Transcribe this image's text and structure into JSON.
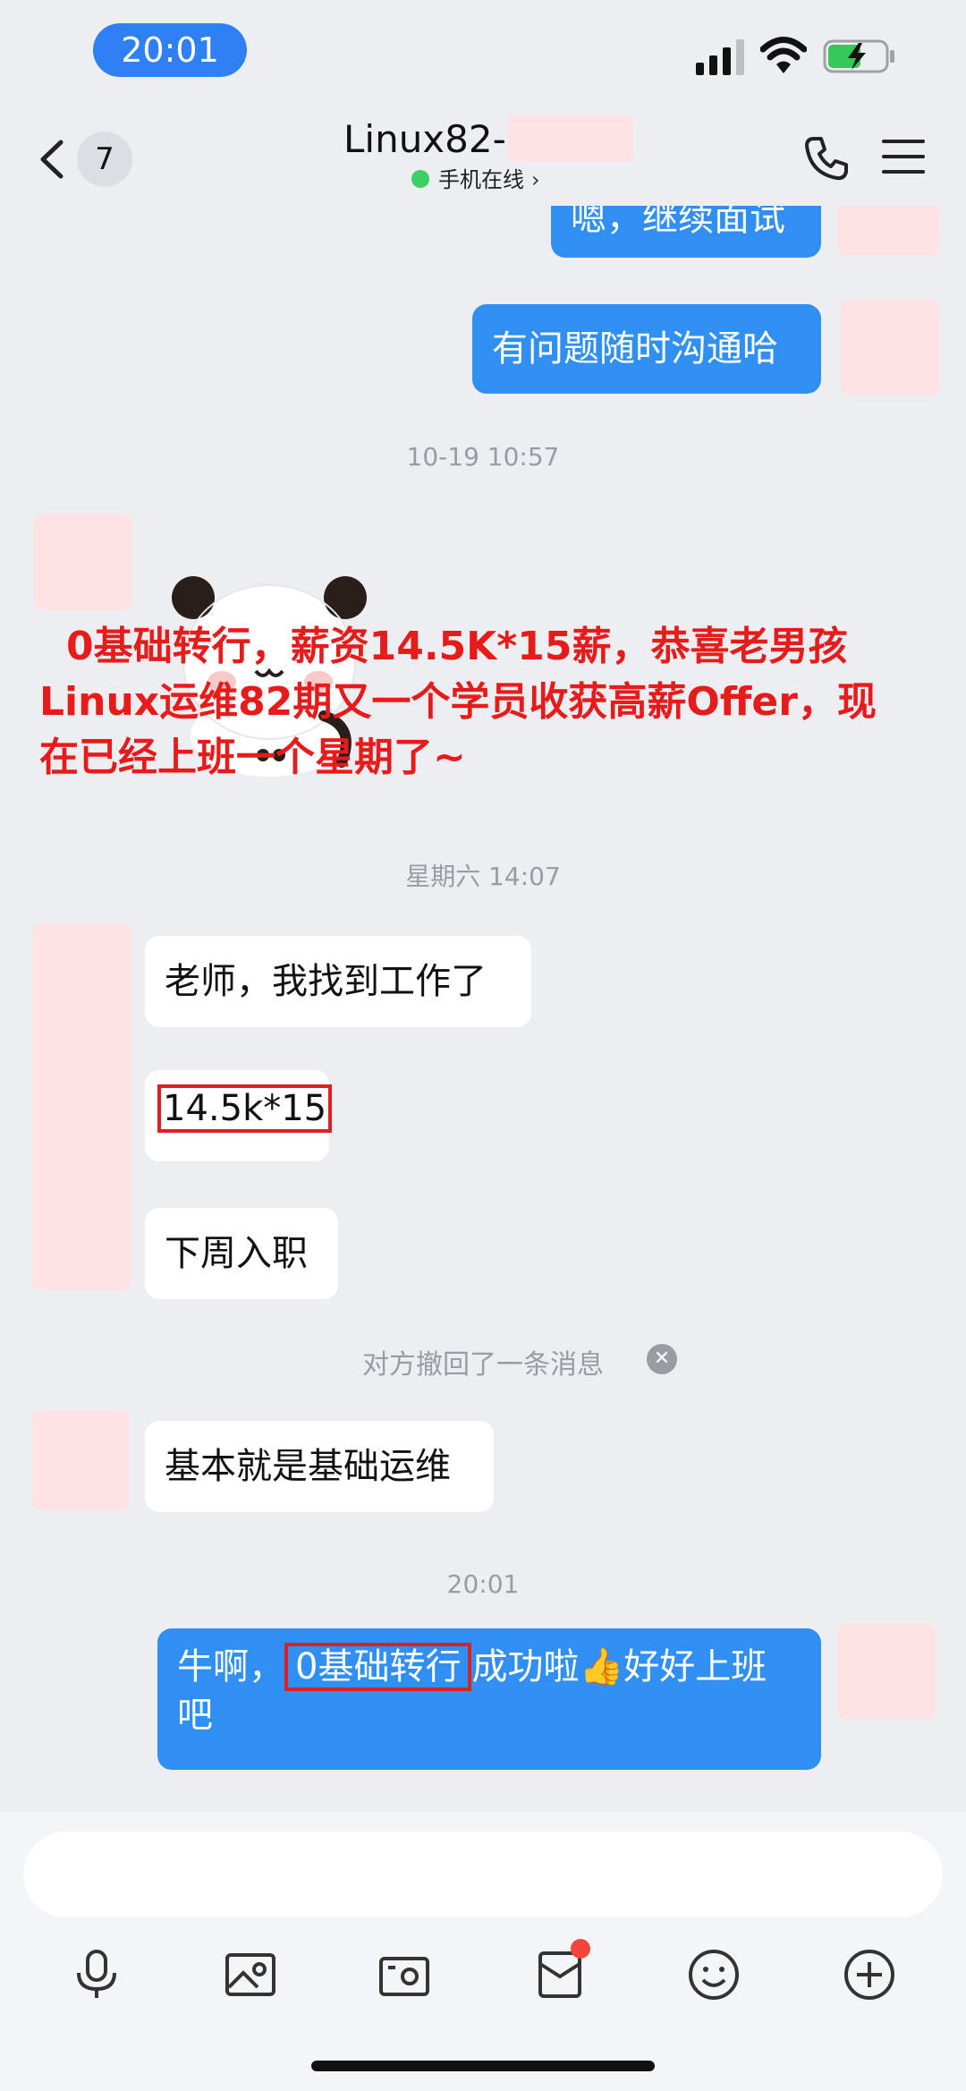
{
  "status_bar": {
    "time": "20:01"
  },
  "header": {
    "back_count": "7",
    "title": "Linux82-",
    "online_status": "手机在线",
    "online_chevron": "›"
  },
  "messages": {
    "top_partial": "嗯，继续面试",
    "m1": "有问题随时沟通哈",
    "ts1": "10-19 10:57",
    "ts2": "星期六 14:07",
    "m2": "老师，我找到工作了",
    "m3": "14.5k*15",
    "m4": "下周入职",
    "recall": "对方撤回了一条消息",
    "recall_close": "✕",
    "m5": "基本就是基础运维",
    "ts3": "20:01",
    "m6_a": "牛啊，",
    "m6_hl": "0基础转行",
    "m6_b": "成功啦👍好好上班吧"
  },
  "overlay": {
    "line1": "0基础转行，薪资14.5K*15薪，恭喜老男孩",
    "line2": "Linux运维82期又一个学员收获高薪Offer，现",
    "line3": "在已经上班一个星期了~"
  },
  "toolbar": {
    "icons": [
      "microphone-icon",
      "image-icon",
      "camera-icon",
      "red-packet-icon",
      "emoji-icon",
      "plus-icon"
    ]
  },
  "colors": {
    "accent": "#2f8ff3",
    "highlight": "#e02020",
    "overlay_text": "#e81b1b",
    "background": "#eceef2"
  }
}
